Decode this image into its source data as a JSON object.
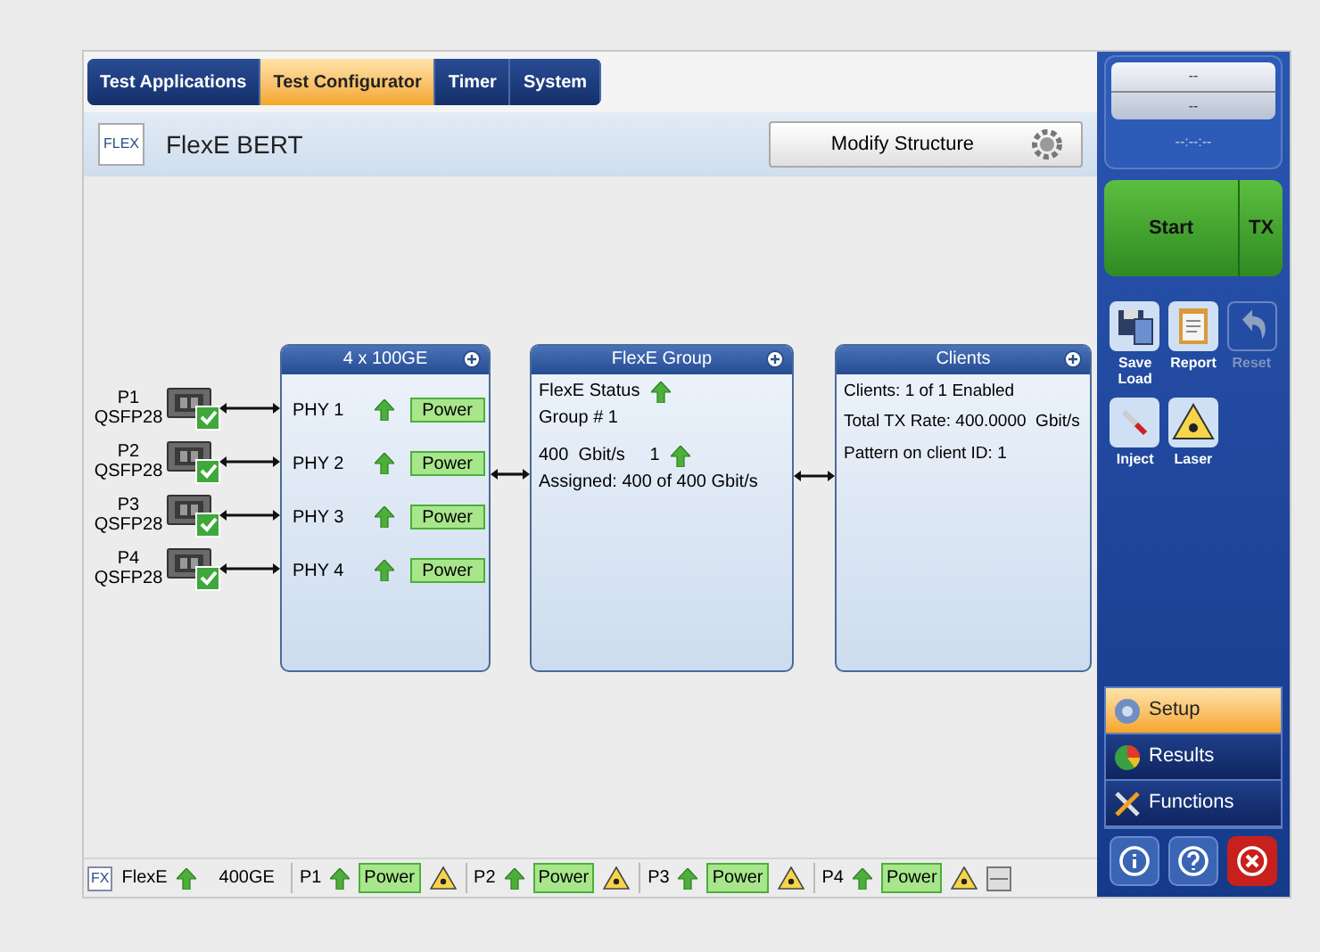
{
  "tabs": [
    {
      "label": "Test Applications",
      "selected": false
    },
    {
      "label": "Test Configurator",
      "selected": true
    },
    {
      "label": "Timer",
      "selected": false
    },
    {
      "label": "System",
      "selected": false
    }
  ],
  "header": {
    "logo": "FLEX",
    "title": "FlexE BERT",
    "button": "Modify Structure"
  },
  "ports": [
    {
      "name": "P1",
      "type": "QSFP28",
      "checked": true
    },
    {
      "name": "P2",
      "type": "QSFP28",
      "checked": true
    },
    {
      "name": "P3",
      "type": "QSFP28",
      "checked": true
    },
    {
      "name": "P4",
      "type": "QSFP28",
      "checked": true
    }
  ],
  "phy_box": {
    "title": "4 x 100GE",
    "rows": [
      {
        "label": "PHY 1",
        "status": "Power"
      },
      {
        "label": "PHY 2",
        "status": "Power"
      },
      {
        "label": "PHY 3",
        "status": "Power"
      },
      {
        "label": "PHY 4",
        "status": "Power"
      }
    ]
  },
  "group_box": {
    "title": "FlexE Group",
    "lines": [
      {
        "text": "FlexE Status",
        "up": true
      },
      {
        "text": "Group # 1",
        "up": false
      },
      {
        "text": "400  Gbit/s     1",
        "up": true
      },
      {
        "text": "Assigned: 400 of 400 Gbit/s",
        "up": false
      }
    ]
  },
  "clients_box": {
    "title": "Clients",
    "lines": [
      "Clients: 1 of 1 Enabled",
      "Total TX Rate: 400.0000  Gbit/s",
      "Pattern on client ID: 1"
    ]
  },
  "right_panel": {
    "display": [
      "--",
      "--",
      "--:--:--"
    ],
    "start": "Start",
    "tx": "TX",
    "tools": [
      {
        "kind": "save",
        "label": "Save Load",
        "disabled": false
      },
      {
        "kind": "report",
        "label": "Report",
        "disabled": false
      },
      {
        "kind": "reset",
        "label": "Reset",
        "disabled": true
      },
      {
        "kind": "inject",
        "label": "Inject",
        "disabled": false
      },
      {
        "kind": "laser",
        "label": "Laser",
        "disabled": false
      }
    ],
    "nav": [
      {
        "kind": "setup",
        "label": "Setup",
        "selected": true
      },
      {
        "kind": "results",
        "label": "Results",
        "selected": false
      },
      {
        "kind": "functions",
        "label": "Functions",
        "selected": false
      }
    ]
  },
  "status_bar": {
    "logo": "FX",
    "name": "FlexE",
    "rate": "400GE",
    "ports": [
      {
        "name": "P1",
        "status": "Power"
      },
      {
        "name": "P2",
        "status": "Power"
      },
      {
        "name": "P3",
        "status": "Power"
      },
      {
        "name": "P4",
        "status": "Power"
      }
    ]
  }
}
